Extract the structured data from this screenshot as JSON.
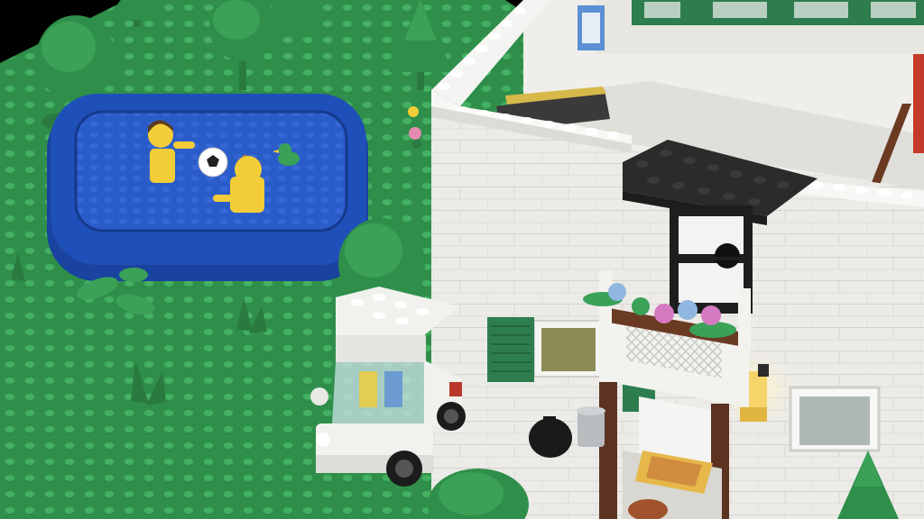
{
  "scene": {
    "kind": "lego-render",
    "colors": {
      "background": "#000000",
      "baseplate": "#2f8f4a",
      "baseplate_stud": "#3aa157",
      "pool": "#1f4fb8",
      "pool_inner": "#2a5cc9",
      "wall": "#ecebe7",
      "wall_shadow": "#cfcfc9",
      "roof_dark": "#2b2b2b",
      "shutter": "#2e7d4f",
      "railing": "#6b3a22",
      "tree": "#2f8f4a",
      "trunk": "#2f8f4a",
      "cart_body": "#efefec",
      "minifig": "#f2cd37",
      "lamp": "#f6d46a"
    },
    "objects": [
      {
        "name": "pool",
        "label": ""
      },
      {
        "name": "house",
        "label": ""
      },
      {
        "name": "golf-cart",
        "label": ""
      },
      {
        "name": "balcony",
        "label": ""
      }
    ]
  }
}
